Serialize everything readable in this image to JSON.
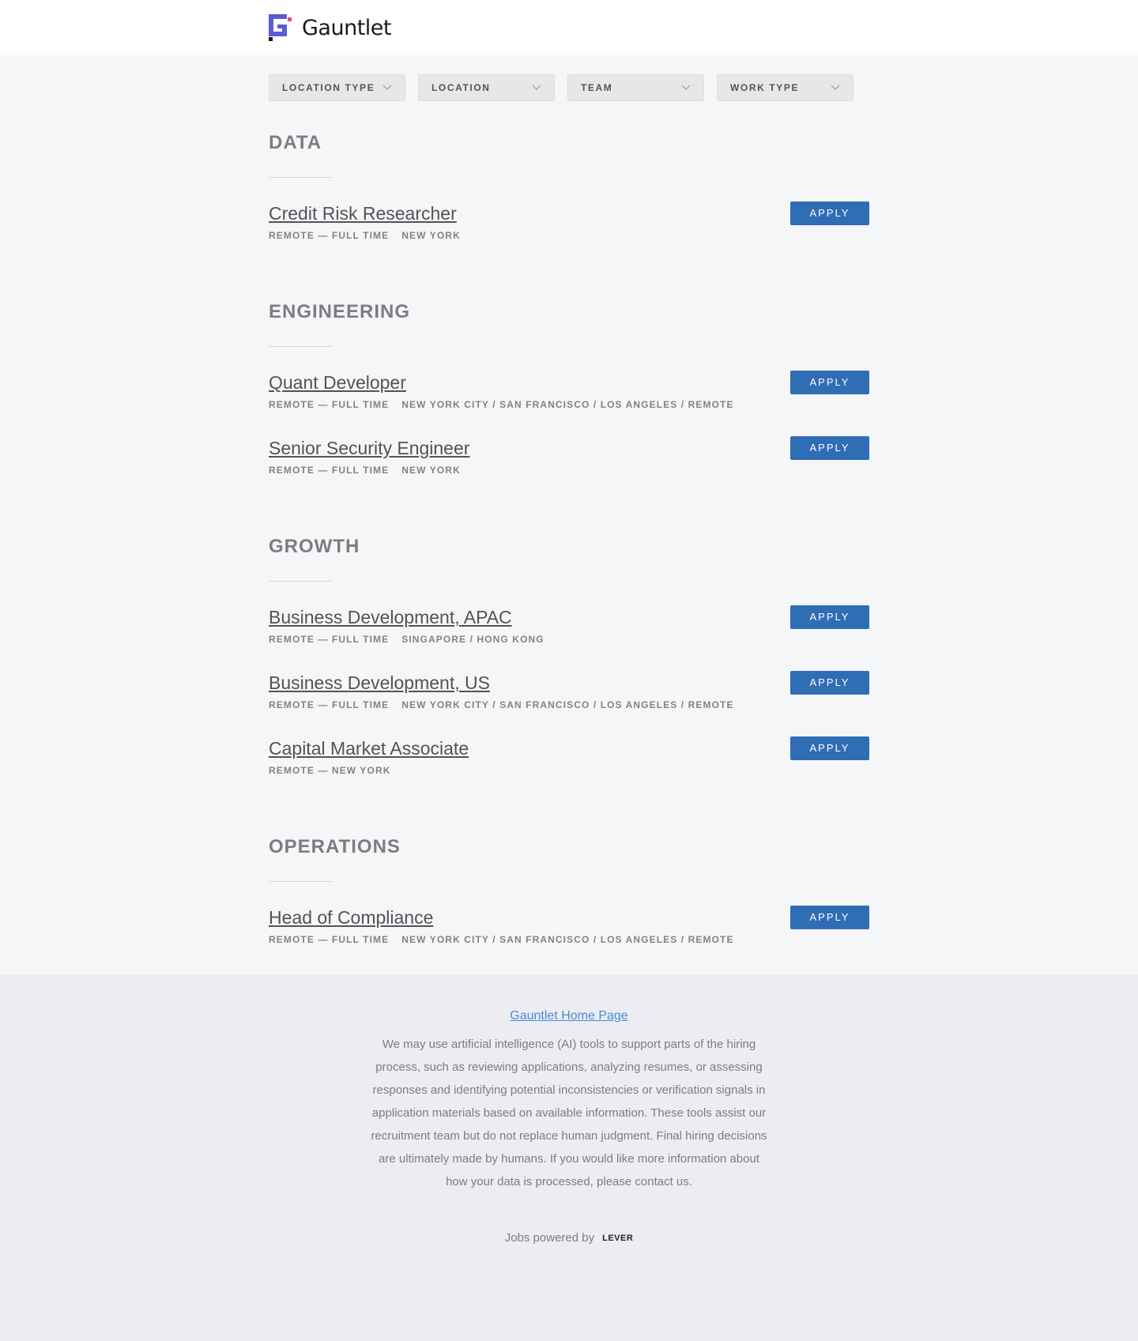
{
  "header": {
    "brand": "Gauntlet",
    "logo_icon": "gauntlet-logo",
    "logo_colors": {
      "primary": "#5b5bd6",
      "accent": "#ea4c89",
      "dark": "#1a1a1a"
    }
  },
  "filters": [
    {
      "label": "LOCATION TYPE"
    },
    {
      "label": "LOCATION"
    },
    {
      "label": "TEAM"
    },
    {
      "label": "WORK TYPE"
    }
  ],
  "groups": [
    {
      "title": "DATA",
      "postings": [
        {
          "title": "Credit Risk Researcher",
          "commitment": "REMOTE — FULL TIME",
          "location": "NEW YORK",
          "apply": "APPLY"
        }
      ]
    },
    {
      "title": "ENGINEERING",
      "postings": [
        {
          "title": "Quant Developer",
          "commitment": "REMOTE — FULL TIME",
          "location": "NEW YORK CITY / SAN FRANCISCO / LOS ANGELES / REMOTE",
          "apply": "APPLY"
        },
        {
          "title": "Senior Security Engineer",
          "commitment": "REMOTE — FULL TIME",
          "location": "NEW YORK",
          "apply": "APPLY"
        }
      ]
    },
    {
      "title": "GROWTH",
      "postings": [
        {
          "title": "Business Development, APAC",
          "commitment": "REMOTE — FULL TIME",
          "location": "SINGAPORE / HONG KONG",
          "apply": "APPLY"
        },
        {
          "title": "Business Development, US",
          "commitment": "REMOTE — FULL TIME",
          "location": "NEW YORK CITY / SAN FRANCISCO / LOS ANGELES / REMOTE",
          "apply": "APPLY"
        },
        {
          "title": "Capital Market Associate",
          "commitment": "REMOTE — NEW YORK",
          "location": "",
          "apply": "APPLY"
        }
      ]
    },
    {
      "title": "OPERATIONS",
      "postings": [
        {
          "title": "Head of Compliance",
          "commitment": "REMOTE — FULL TIME",
          "location": "NEW YORK CITY / SAN FRANCISCO / LOS ANGELES / REMOTE",
          "apply": "APPLY"
        }
      ]
    }
  ],
  "footer": {
    "home_link": "Gauntlet Home Page",
    "disclaimer": "We may use artificial intelligence (AI) tools to support parts of the hiring process, such as reviewing applications, analyzing resumes, or assessing responses and identifying potential inconsistencies or verification signals in application materials based on available information. These tools assist our recruitment team but do not replace human judgment. Final hiring decisions are ultimately made by humans. If you would like more information about how your data is processed, please contact us.",
    "powered_by": "Jobs powered by",
    "lever": "LEVER"
  },
  "colors": {
    "apply_button": "#2f6db5",
    "link": "#4a8ad8",
    "page_bg": "#f5f6f7",
    "footer_bg": "#ebedf0"
  }
}
